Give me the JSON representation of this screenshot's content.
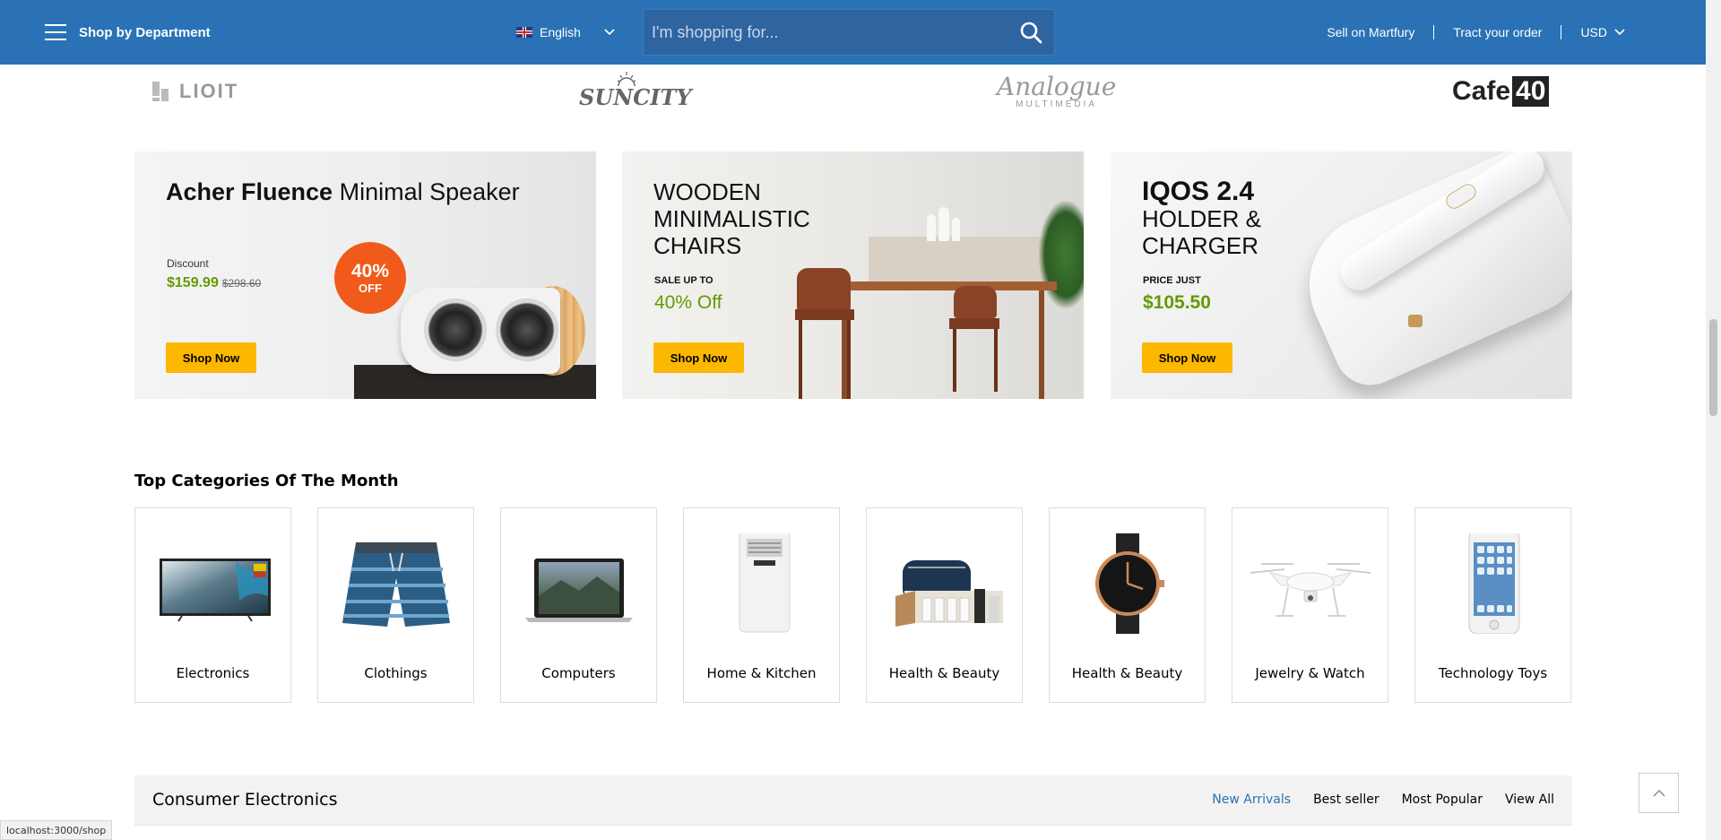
{
  "header": {
    "department_label": "Shop by Department",
    "language": "English",
    "search_placeholder": "I'm shopping for...",
    "links": [
      "Sell on Martfury",
      "Tract your order"
    ],
    "currency": "USD",
    "bg_color": "#2a72b5"
  },
  "brands": {
    "lioit": "LIOIT",
    "suncity": "SUNCITY",
    "analogue": "Analogue",
    "analogue_sub": "MULTIMEDIA",
    "cafe": "Cafe",
    "cafe_num": "40"
  },
  "banners": [
    {
      "title_bold": "Acher Fluence",
      "title_rest": "Minimal Speaker",
      "small_label": "Discount",
      "price": "$159.99",
      "old_price": "$298.60",
      "badge_percent": "40%",
      "badge_off": "OFF",
      "button": "Shop Now"
    },
    {
      "title_line1": "WOODEN",
      "title_line2": "MINIMALISTIC",
      "title_line3": "CHAIRS",
      "small_label": "SALE UP TO",
      "offer": "40% Off",
      "button": "Shop Now"
    },
    {
      "title_bold": "IQOS 2.4",
      "title_line2": "HOLDER &",
      "title_line3": "CHARGER",
      "small_label": "PRICE JUST",
      "price": "$105.50",
      "button": "Shop Now"
    }
  ],
  "categories_title": "Top Categories Of The Month",
  "categories": [
    {
      "label": "Electronics",
      "icon": "tv-icon"
    },
    {
      "label": "Clothings",
      "icon": "shorts-icon"
    },
    {
      "label": "Computers",
      "icon": "laptop-icon"
    },
    {
      "label": "Home & Kitchen",
      "icon": "air-conditioner-icon"
    },
    {
      "label": "Health & Beauty",
      "icon": "grooming-kit-icon"
    },
    {
      "label": "Health & Beauty",
      "icon": "watch-icon"
    },
    {
      "label": "Jewelry & Watch",
      "icon": "drone-icon"
    },
    {
      "label": "Technology Toys",
      "icon": "smartphone-icon"
    }
  ],
  "consumer_electronics": {
    "title": "Consumer Electronics",
    "tabs": [
      "New Arrivals",
      "Best seller",
      "Most Popular",
      "View All"
    ],
    "active_tab": "New Arrivals",
    "active_color": "#2a72b5"
  },
  "status_url": "localhost:3000/shop",
  "accent_colors": {
    "button_yellow": "#fcb800",
    "price_green": "#669900",
    "badge_orange": "#f05a1a"
  }
}
